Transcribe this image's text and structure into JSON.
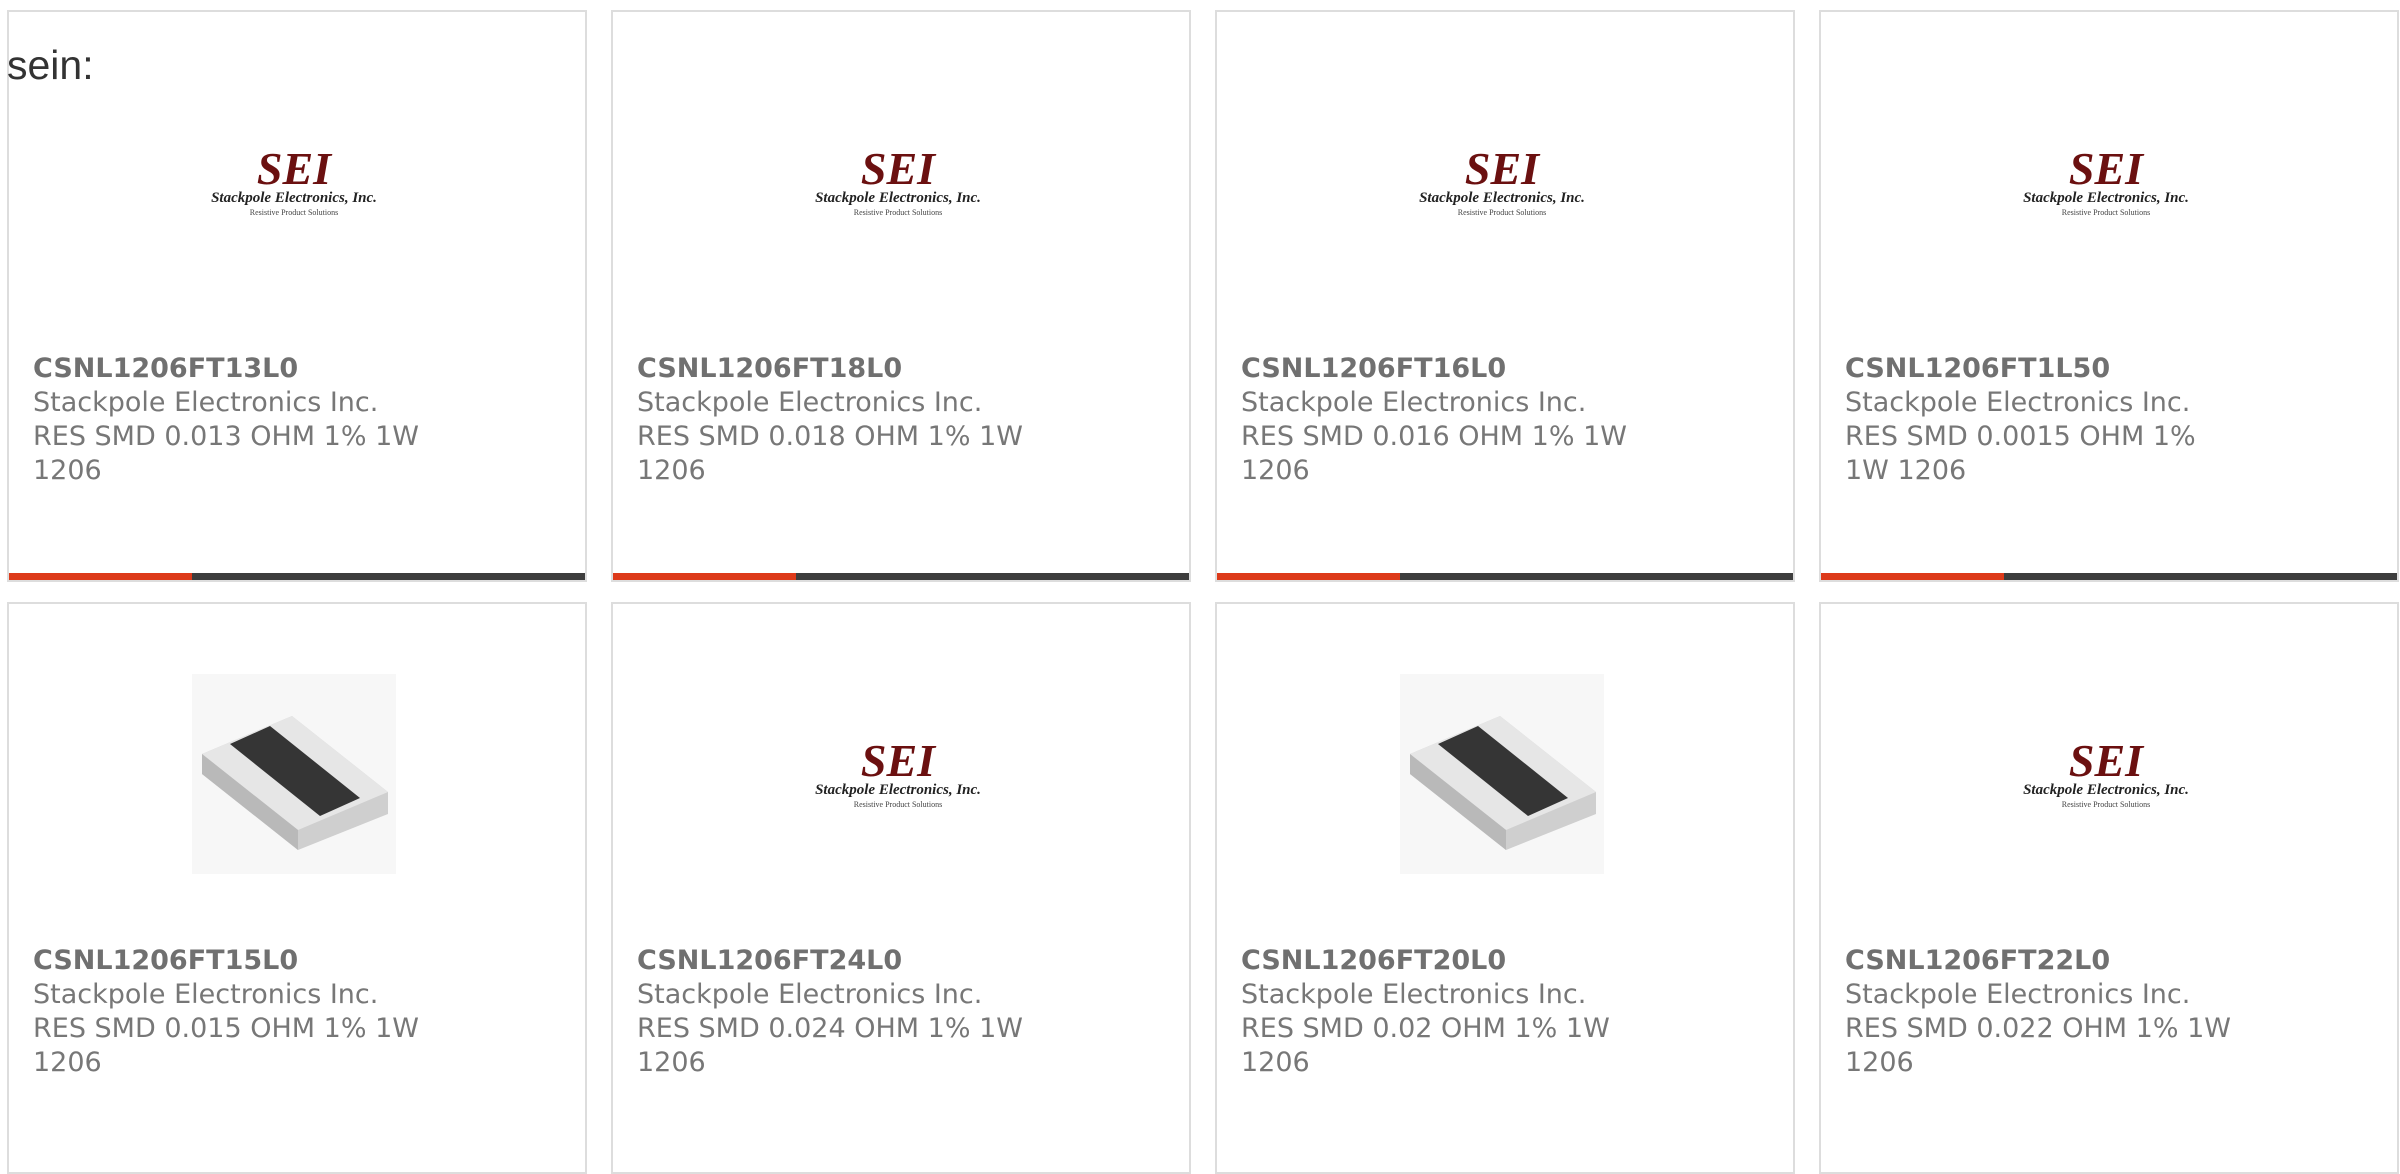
{
  "intro_text": "sein:",
  "colors": {
    "accent": "#dd3a1a",
    "bar": "#3d3d3d",
    "logo": "#6b1010",
    "text": "#777777"
  },
  "products": [
    {
      "part_number": "CSNL1206FT13L0",
      "manufacturer": "Stackpole Electronics Inc.",
      "description": "RES SMD 0.013 OHM 1% 1W 1206",
      "image": "sei-logo"
    },
    {
      "part_number": "CSNL1206FT18L0",
      "manufacturer": "Stackpole Electronics Inc.",
      "description": "RES SMD 0.018 OHM 1% 1W 1206",
      "image": "sei-logo"
    },
    {
      "part_number": "CSNL1206FT16L0",
      "manufacturer": "Stackpole Electronics Inc.",
      "description": "RES SMD 0.016 OHM 1% 1W 1206",
      "image": "sei-logo"
    },
    {
      "part_number": "CSNL1206FT1L50",
      "manufacturer": "Stackpole Electronics Inc.",
      "description": "RES SMD 0.0015 OHM 1% 1W 1206",
      "image": "sei-logo"
    },
    {
      "part_number": "CSNL1206FT15L0",
      "manufacturer": "Stackpole Electronics Inc.",
      "description": "RES SMD 0.015 OHM 1% 1W 1206",
      "image": "resistor-chip"
    },
    {
      "part_number": "CSNL1206FT24L0",
      "manufacturer": "Stackpole Electronics Inc.",
      "description": "RES SMD 0.024 OHM 1% 1W 1206",
      "image": "sei-logo"
    },
    {
      "part_number": "CSNL1206FT20L0",
      "manufacturer": "Stackpole Electronics Inc.",
      "description": "RES SMD 0.02 OHM 1% 1W 1206",
      "image": "resistor-chip"
    },
    {
      "part_number": "CSNL1206FT22L0",
      "manufacturer": "Stackpole Electronics Inc.",
      "description": "RES SMD 0.022 OHM 1% 1W 1206",
      "image": "sei-logo"
    }
  ],
  "logo": {
    "mark": "SEI",
    "company": "Stackpole Electronics, Inc.",
    "tagline": "Resistive Product Solutions"
  }
}
